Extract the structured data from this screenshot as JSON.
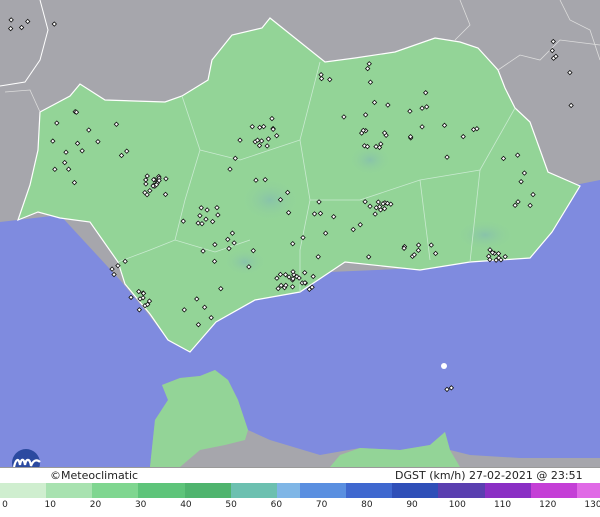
{
  "credit": "©Meteoclimatic",
  "variable_label": "DGST (km/h)",
  "timestamp": "27-02-2021 @ 23:51 UTC",
  "logo_icon": "meteoclimatic-logo-icon",
  "scale": {
    "ticks": [
      "0",
      "10",
      "20",
      "30",
      "40",
      "50",
      "60",
      "70",
      "80",
      "90",
      "100",
      "110",
      "120",
      "130"
    ],
    "colors": [
      "#cfeecf",
      "#a8e2b0",
      "#7fd690",
      "#5ec47a",
      "#4fb46e",
      "#6cc0b0",
      "#7fb6e6",
      "#5a8fe0",
      "#3f68cf",
      "#2f4fb8",
      "#5a3fb0",
      "#8a2fc4",
      "#c43fd6",
      "#e06ae6"
    ]
  },
  "colors": {
    "sea": "#7f8bdf",
    "land_andalusia": "#93d497",
    "land_other": "#a6a6ac",
    "station": "#111111"
  },
  "stations": {
    "count": 260,
    "marker_icon": "station-diamond-icon"
  }
}
